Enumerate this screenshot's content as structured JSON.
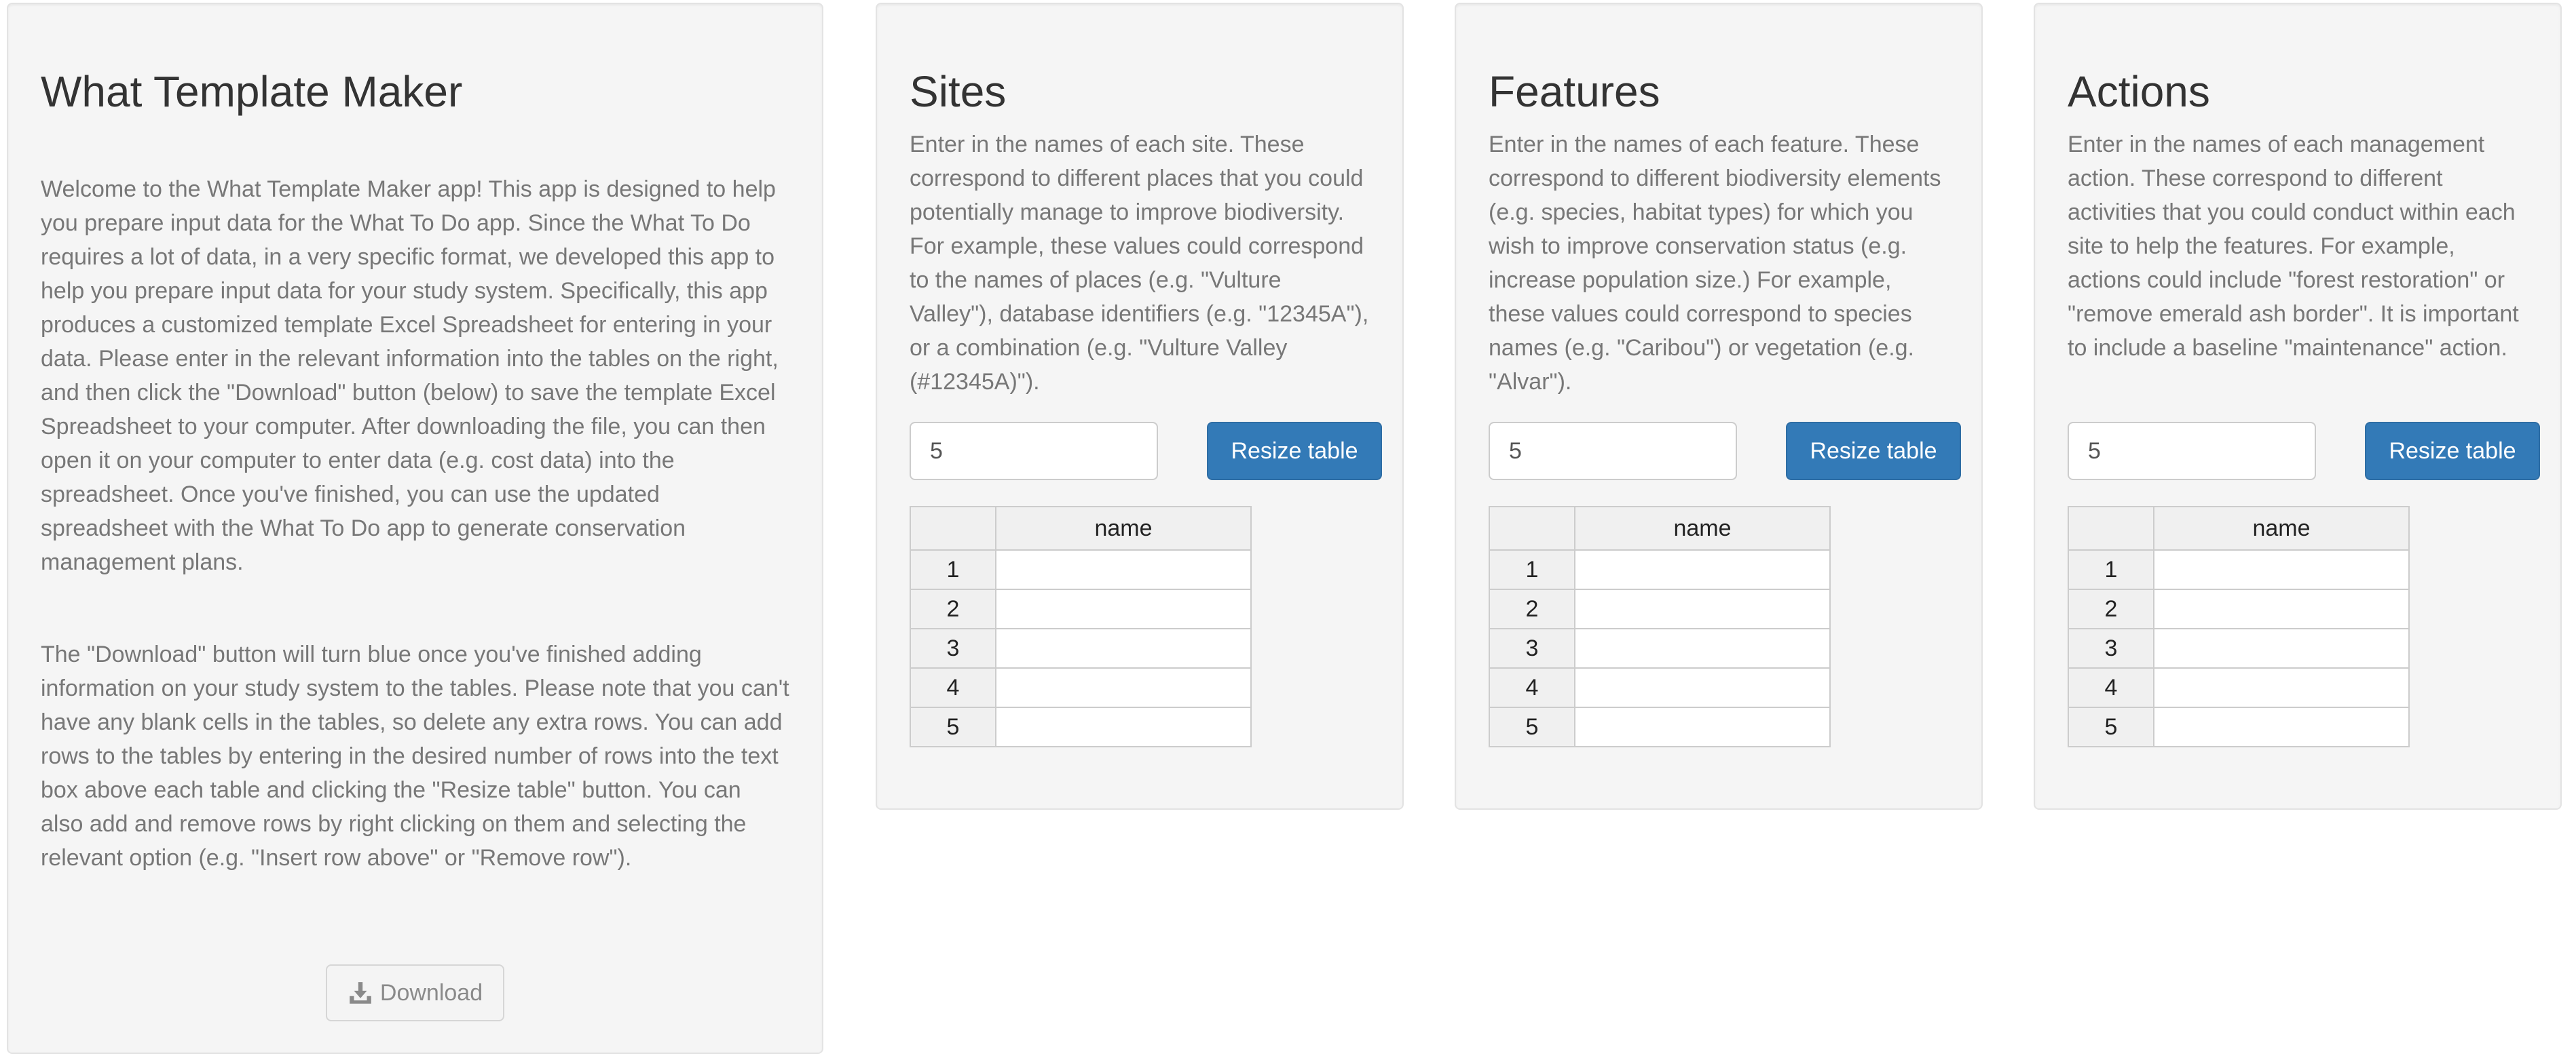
{
  "intro": {
    "title": "What Template Maker",
    "paragraph1": "Welcome to the What Template Maker app! This app is designed to help you prepare input data for the What To Do app. Since the What To Do requires a lot of data, in a very specific format, we developed this app to help you prepare input data for your study system. Specifically, this app produces a customized template Excel Spreadsheet for entering in your data. Please enter in the relevant information into the tables on the right, and then click the \"Download\" button (below) to save the template Excel Spreadsheet to your computer. After downloading the file, you can then open it on your computer to enter data (e.g. cost data) into the spreadsheet. Once you've finished, you can use the updated spreadsheet with the What To Do app to generate conservation management plans.",
    "paragraph2": "The \"Download\" button will turn blue once you've finished adding information on your study system to the tables. Please note that you can't have any blank cells in the tables, so delete any extra rows. You can add rows to the tables by entering in the desired number of rows into the text box above each table and clicking the \"Resize table\" button. You can also add and remove rows by right clicking on them and selecting the relevant option (e.g. \"Insert row above\" or \"Remove row\").",
    "download_label": "Download",
    "download_icon": "download-icon"
  },
  "sites": {
    "title": "Sites",
    "description": "Enter in the names of each site. These correspond to different places that you could potentially manage to improve biodiversity. For example, these values could correspond to the names of places (e.g. \"Vulture Valley\"), database identifiers (e.g. \"12345A\"), or a combination (e.g. \"Vulture Valley (#12345A)\").",
    "rows_value": "5",
    "resize_label": "Resize table",
    "column_header": "name",
    "row_numbers": [
      "1",
      "2",
      "3",
      "4",
      "5"
    ],
    "cells": [
      "",
      "",
      "",
      "",
      ""
    ]
  },
  "features": {
    "title": "Features",
    "description": "Enter in the names of each feature. These correspond to different biodiversity elements (e.g. species, habitat types) for which you wish to improve conservation status (e.g. increase population size.) For example, these values could correspond to species names (e.g. \"Caribou\") or vegetation (e.g. \"Alvar\").",
    "rows_value": "5",
    "resize_label": "Resize table",
    "column_header": "name",
    "row_numbers": [
      "1",
      "2",
      "3",
      "4",
      "5"
    ],
    "cells": [
      "",
      "",
      "",
      "",
      ""
    ]
  },
  "actions": {
    "title": "Actions",
    "description": "Enter in the names of each management action. These correspond to different activities that you could conduct within each site to help the features. For example, actions could include \"forest restoration\" or \"remove emerald ash border\". It is important to include a baseline \"maintenance\" action.",
    "rows_value": "5",
    "resize_label": "Resize table",
    "column_header": "name",
    "row_numbers": [
      "1",
      "2",
      "3",
      "4",
      "5"
    ],
    "cells": [
      "",
      "",
      "",
      "",
      ""
    ]
  },
  "colors": {
    "primary_button": "#337ab7",
    "well_background": "#f5f5f5",
    "muted_text": "#777777"
  }
}
